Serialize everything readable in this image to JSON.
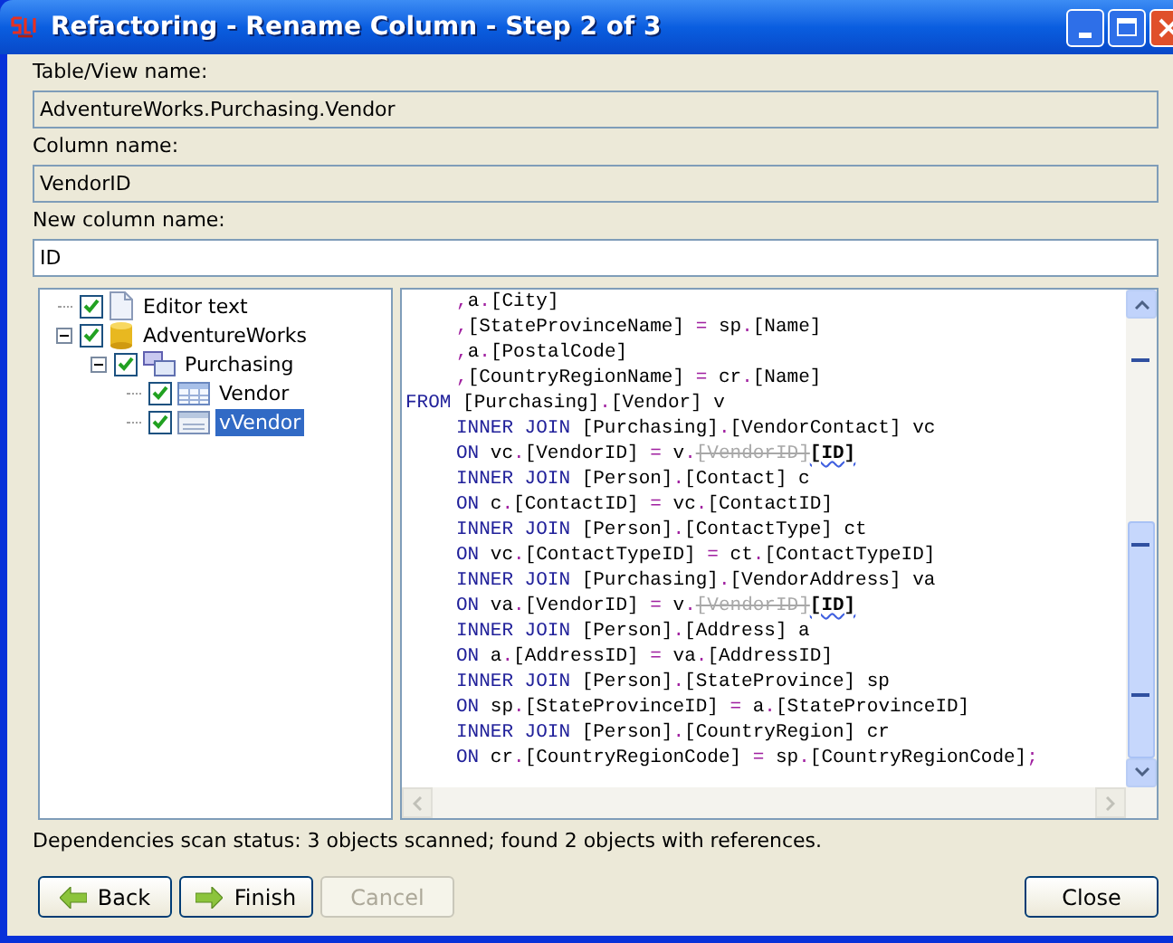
{
  "window": {
    "title": "Refactoring - Rename Column - Step 2 of 3"
  },
  "fields": [
    {
      "label": "Table/View name:",
      "value": "AdventureWorks.Purchasing.Vendor",
      "disabled": true
    },
    {
      "label": "Column name:",
      "value": "VendorID",
      "disabled": true
    },
    {
      "label": "New column name:",
      "value": "ID",
      "disabled": false
    }
  ],
  "tree": [
    {
      "label": "Editor text",
      "kind": "document",
      "checked": true,
      "selected": false
    },
    {
      "label": "AdventureWorks",
      "kind": "database",
      "checked": true,
      "selected": false,
      "expanded": true,
      "children": [
        {
          "label": "Purchasing",
          "kind": "schema",
          "checked": true,
          "selected": false,
          "expanded": true,
          "children": [
            {
              "label": "Vendor",
              "kind": "table",
              "checked": true,
              "selected": false
            },
            {
              "label": "vVendor",
              "kind": "view",
              "checked": true,
              "selected": true
            }
          ]
        }
      ]
    }
  ],
  "code": [
    {
      "kind": "indented",
      "tokens": [
        {
          "kind": "text",
          "text": ",a.[City]"
        }
      ]
    },
    {
      "kind": "indented",
      "tokens": [
        {
          "kind": "text",
          "text": ",[StateProvinceName] = sp.[Name]"
        }
      ]
    },
    {
      "kind": "indented",
      "tokens": [
        {
          "kind": "text",
          "text": ",a.[PostalCode]"
        }
      ]
    },
    {
      "kind": "indented",
      "tokens": [
        {
          "kind": "text",
          "text": ",[CountryRegionName] = cr.[Name]"
        }
      ]
    },
    {
      "kind": "top",
      "tokens": [
        {
          "kind": "keyword",
          "text": "FROM"
        },
        {
          "kind": "text",
          "text": " [Purchasing].[Vendor] v"
        }
      ]
    },
    {
      "kind": "indented",
      "tokens": [
        {
          "kind": "keyword",
          "text": "INNER JOIN"
        },
        {
          "kind": "text",
          "text": " [Purchasing].[VendorContact] vc"
        }
      ]
    },
    {
      "kind": "indented",
      "tokens": [
        {
          "kind": "keyword",
          "text": "ON"
        },
        {
          "kind": "text",
          "text": " vc.[VendorID] = v."
        },
        {
          "kind": "removed",
          "text": "[VendorID]"
        },
        {
          "kind": "inserted",
          "text": "[ID]"
        }
      ]
    },
    {
      "kind": "indented",
      "tokens": [
        {
          "kind": "keyword",
          "text": "INNER JOIN"
        },
        {
          "kind": "text",
          "text": " [Person].[Contact] c"
        }
      ]
    },
    {
      "kind": "indented",
      "tokens": [
        {
          "kind": "keyword",
          "text": "ON"
        },
        {
          "kind": "text",
          "text": " c.[ContactID] = vc.[ContactID]"
        }
      ]
    },
    {
      "kind": "indented",
      "tokens": [
        {
          "kind": "keyword",
          "text": "INNER JOIN"
        },
        {
          "kind": "text",
          "text": " [Person].[ContactType] ct"
        }
      ]
    },
    {
      "kind": "indented",
      "tokens": [
        {
          "kind": "keyword",
          "text": "ON"
        },
        {
          "kind": "text",
          "text": " vc.[ContactTypeID] = ct.[ContactTypeID]"
        }
      ]
    },
    {
      "kind": "indented",
      "tokens": [
        {
          "kind": "keyword",
          "text": "INNER JOIN"
        },
        {
          "kind": "text",
          "text": " [Purchasing].[VendorAddress] va"
        }
      ]
    },
    {
      "kind": "indented",
      "tokens": [
        {
          "kind": "keyword",
          "text": "ON"
        },
        {
          "kind": "text",
          "text": " va.[VendorID] = v."
        },
        {
          "kind": "removed",
          "text": "[VendorID]"
        },
        {
          "kind": "inserted",
          "text": "[ID]"
        }
      ]
    },
    {
      "kind": "indented",
      "tokens": [
        {
          "kind": "keyword",
          "text": "INNER JOIN"
        },
        {
          "kind": "text",
          "text": " [Person].[Address] a"
        }
      ]
    },
    {
      "kind": "indented",
      "tokens": [
        {
          "kind": "keyword",
          "text": "ON"
        },
        {
          "kind": "text",
          "text": " a.[AddressID] = va.[AddressID]"
        }
      ]
    },
    {
      "kind": "indented",
      "tokens": [
        {
          "kind": "keyword",
          "text": "INNER JOIN"
        },
        {
          "kind": "text",
          "text": " [Person].[StateProvince] sp"
        }
      ]
    },
    {
      "kind": "indented",
      "tokens": [
        {
          "kind": "keyword",
          "text": "ON"
        },
        {
          "kind": "text",
          "text": " sp.[StateProvinceID] = a.[StateProvinceID]"
        }
      ]
    },
    {
      "kind": "indented",
      "tokens": [
        {
          "kind": "keyword",
          "text": "INNER JOIN"
        },
        {
          "kind": "text",
          "text": " [Person].[CountryRegion] cr"
        }
      ]
    },
    {
      "kind": "indented",
      "tokens": [
        {
          "kind": "keyword",
          "text": "ON"
        },
        {
          "kind": "text",
          "text": " cr.[CountryRegionCode] = sp.[CountryRegionCode];"
        }
      ]
    }
  ],
  "status_bar": {
    "text": "Dependencies scan status: 3 objects scanned; found 2 objects with references."
  },
  "buttons": [
    {
      "label": "Back",
      "kind": "back",
      "disabled": false
    },
    {
      "label": "Finish",
      "kind": "next",
      "disabled": false
    },
    {
      "label": "Cancel",
      "kind": "plain",
      "disabled": true
    },
    {
      "label": "Close",
      "kind": "close",
      "disabled": false
    }
  ]
}
